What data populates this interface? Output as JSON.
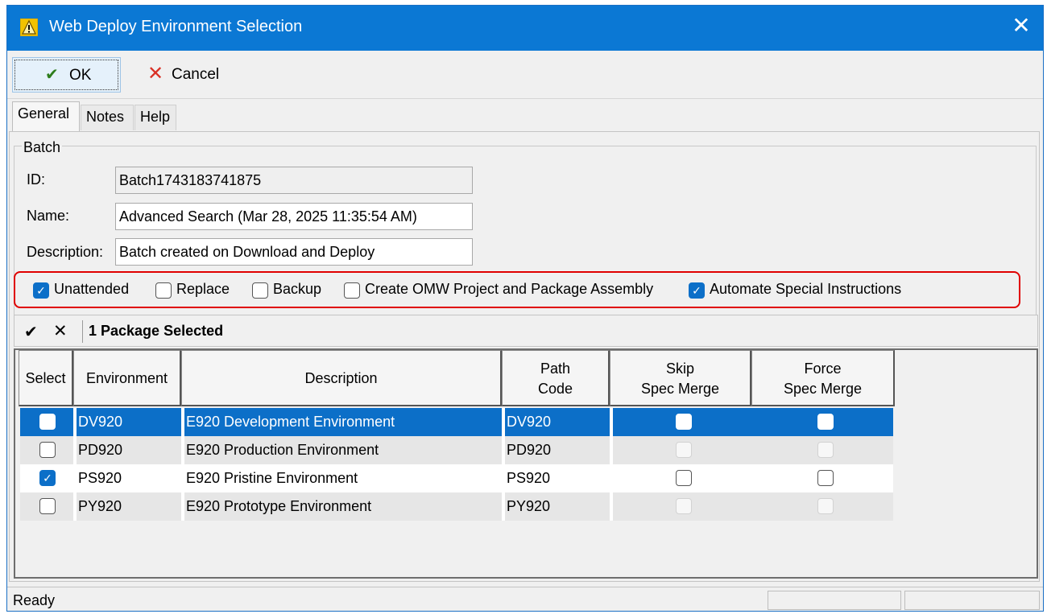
{
  "window": {
    "title": "Web Deploy Environment Selection",
    "app_icon": "warning-triangle-icon",
    "close_icon": "close-icon"
  },
  "toolbar": {
    "ok_label": "OK",
    "cancel_label": "Cancel",
    "ok_icon": "checkmark-icon",
    "cancel_icon": "x-icon"
  },
  "tabs": [
    {
      "label": "General"
    },
    {
      "label": "Notes"
    },
    {
      "label": "Help"
    }
  ],
  "batch": {
    "group_title": "Batch",
    "id_label": "ID:",
    "id_value": "Batch1743183741875",
    "name_label": "Name:",
    "name_value": "Advanced Search (Mar 28, 2025 11:35:54 AM)",
    "description_label": "Description:",
    "description_value": "Batch created on Download and Deploy"
  },
  "options": [
    {
      "label": "Unattended",
      "checked": true
    },
    {
      "label": "Replace",
      "checked": false
    },
    {
      "label": "Backup",
      "checked": false
    },
    {
      "label": "Create OMW Project and Package Assembly",
      "checked": false
    },
    {
      "label": "Automate Special Instructions",
      "checked": true
    }
  ],
  "selection_bar": {
    "check_glyph": "✔",
    "x_glyph": "✕",
    "text": "1 Package Selected"
  },
  "grid": {
    "headers": [
      {
        "line1": "Select",
        "line2": ""
      },
      {
        "line1": "Environment",
        "line2": ""
      },
      {
        "line1": "Description",
        "line2": ""
      },
      {
        "line1": "Path",
        "line2": "Code"
      },
      {
        "line1": "Skip",
        "line2": "Spec Merge"
      },
      {
        "line1": "Force",
        "line2": "Spec Merge"
      }
    ],
    "rows": [
      {
        "select": false,
        "environment": "DV920",
        "description": "E920 Development Environment",
        "path_code": "DV920",
        "skip": false,
        "force": false,
        "state": "selected"
      },
      {
        "select": false,
        "environment": "PD920",
        "description": "E920 Production Environment",
        "path_code": "PD920",
        "skip": false,
        "force": false,
        "state": "disabled"
      },
      {
        "select": true,
        "environment": "PS920",
        "description": "E920 Pristine Environment",
        "path_code": "PS920",
        "skip": false,
        "force": false,
        "state": "enabled"
      },
      {
        "select": false,
        "environment": "PY920",
        "description": "E920 Prototype Environment",
        "path_code": "PY920",
        "skip": false,
        "force": false,
        "state": "disabled"
      }
    ]
  },
  "status": {
    "text": "Ready"
  },
  "colors": {
    "title_bar": "#0b78d4",
    "selection": "#0c6fc8",
    "highlight_border": "#e00000"
  }
}
